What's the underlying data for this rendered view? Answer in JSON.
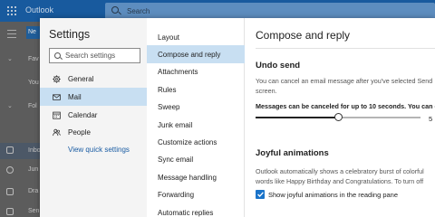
{
  "app": {
    "title": "Outlook",
    "search_label": "Search"
  },
  "nav": {
    "new_label": "Ne",
    "items": [
      {
        "label": "Fav"
      },
      {
        "label": "You"
      },
      {
        "label": "Fol"
      },
      {
        "label": "Inbo"
      },
      {
        "label": "Jun"
      },
      {
        "label": "Dra"
      },
      {
        "label": "Sen"
      }
    ]
  },
  "settings": {
    "title": "Settings",
    "search_placeholder": "Search settings",
    "categories": [
      {
        "label": "General",
        "icon": "gear-icon"
      },
      {
        "label": "Mail",
        "icon": "mail-icon"
      },
      {
        "label": "Calendar",
        "icon": "calendar-icon"
      },
      {
        "label": "People",
        "icon": "people-icon"
      }
    ],
    "selected_category": "Mail",
    "quick_settings_link": "View quick settings",
    "subcategories": [
      "Layout",
      "Compose and reply",
      "Attachments",
      "Rules",
      "Sweep",
      "Junk email",
      "Customize actions",
      "Sync email",
      "Message handling",
      "Forwarding",
      "Automatic replies"
    ],
    "selected_subcategory": "Compose and reply"
  },
  "panel": {
    "title": "Compose and reply",
    "undo_send": {
      "heading": "Undo send",
      "description_line1": "You can cancel an email message after you've selected Send",
      "description_line2": "screen.",
      "cancel_label": "Messages can be canceled for up to 10 seconds. You can c",
      "slider_value": "5",
      "slider_fraction": 0.5
    },
    "joyful": {
      "heading": "Joyful animations",
      "description_line1": "Outlook automatically shows a celebratory burst of colorful",
      "description_line2": "words like Happy Birthday and Congratulations. To turn off",
      "checkbox_label": "Show joyful animations in the reading pane",
      "checkbox_checked": true
    }
  },
  "colors": {
    "brand_bar": "#185a9e",
    "selection": "#c8dff2",
    "checkbox": "#1a73c9",
    "link": "#1a5ca3"
  }
}
